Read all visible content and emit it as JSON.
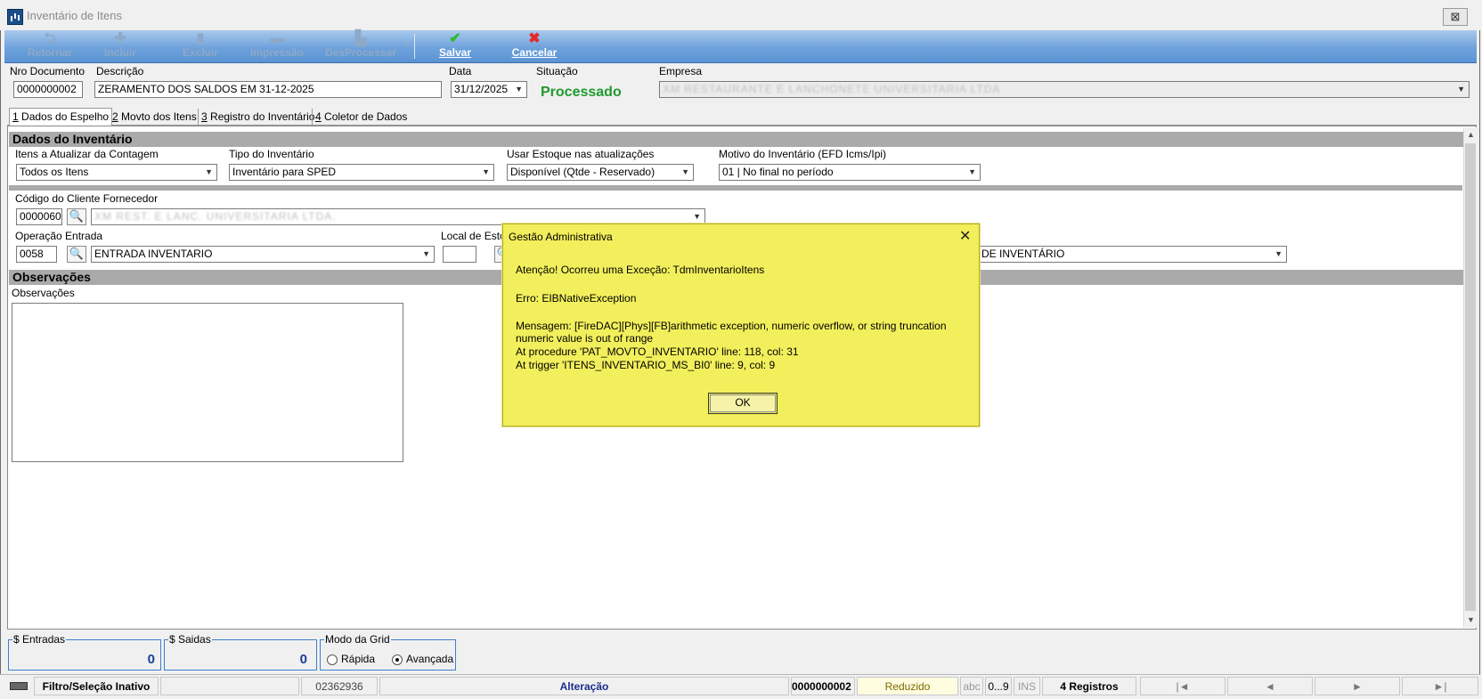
{
  "window": {
    "title": "Inventário de Itens",
    "close_glyph": "⊠"
  },
  "toolbar": {
    "retornar": "Retornar",
    "incluir": "Incluir",
    "excluir": "Excluir",
    "impressao": "Impressão",
    "desprocessar": "DesProcessar",
    "salvar": "Salvar",
    "cancelar": "Cancelar"
  },
  "header": {
    "nro_documento_label": "Nro Documento",
    "nro_documento_value": "0000000002",
    "descricao_label": "Descrição",
    "descricao_value": "ZERAMENTO DOS SALDOS EM 31-12-2025",
    "data_label": "Data",
    "data_value": "31/12/2025",
    "situacao_label": "Situação",
    "situacao_value": "Processado",
    "empresa_label": "Empresa",
    "empresa_value": "XM RESTAURANTE E LANCHONETE UNIVERSITARIA LTDA"
  },
  "tabs": [
    {
      "num": "1",
      "label": " Dados do Espelho"
    },
    {
      "num": "2",
      "label": " Movto dos Itens"
    },
    {
      "num": "3",
      "label": " Registro do Inventário"
    },
    {
      "num": "4",
      "label": " Coletor de Dados"
    }
  ],
  "dados": {
    "section_title": "Dados do Inventário",
    "itens_label": "Itens a Atualizar da Contagem",
    "itens_value": "Todos os Itens",
    "tipo_label": "Tipo do Inventário",
    "tipo_value": "Inventário para SPED",
    "usar_label": "Usar Estoque nas atualizações",
    "usar_value": "Disponível (Qtde - Reservado)",
    "motivo_label": "Motivo do Inventário (EFD Icms/Ipi)",
    "motivo_value": "01 | No final no período",
    "cliente_label": "Código do Cliente Fornecedor",
    "cliente_code": "0000060",
    "cliente_name": "XM REST. E LANC. UNIVERSITARIA LTDA.",
    "operacao_label": "Operação Entrada",
    "operacao_code": "0058",
    "operacao_name": "ENTRADA INVENTARIO",
    "local_label": "Local de Estoque",
    "right_combo_value": "DE INVENTÁRIO"
  },
  "observacoes": {
    "section_title": "Observações",
    "field_label": "Observações",
    "value": ""
  },
  "dialog": {
    "title": "Gestão Administrativa",
    "line1": "Atenção! Ocorreu uma Exceção: TdmInventarioItens",
    "line2": "Erro: EIBNativeException",
    "line3": " Mensagem: [FireDAC][Phys][FB]arithmetic exception, numeric overflow, or string truncation",
    "line4": "numeric value is out of range",
    "line5": "At procedure 'PAT_MOVTO_INVENTARIO' line: 118, col: 31",
    "line6": "At trigger 'ITENS_INVENTARIO_MS_BI0' line: 9, col: 9",
    "ok": "OK"
  },
  "totals": {
    "entradas_label": "$ Entradas",
    "entradas_value": "0",
    "saidas_label": "$ Saidas",
    "saidas_value": "0",
    "modo_label": "Modo da Grid",
    "rapida": "Rápida",
    "avancada": "Avançada",
    "modo_selected": "Avançada"
  },
  "statusbar": {
    "filtro": "Filtro/Seleção Inativo",
    "code": "02362936",
    "mode": "Alteração",
    "doc": "0000000002",
    "reduzido": "Reduzido",
    "abc": "abc",
    "range": "0...9",
    "ins": "INS",
    "registros": "4 Registros",
    "nav_first": "|◄",
    "nav_prev": "◄",
    "nav_next": "►",
    "nav_last": "►|"
  },
  "colors": {
    "toolbar_top": "#a9c9ec",
    "toolbar_bottom": "#5b93d3",
    "dialog_bg": "#f2ef5c",
    "status_ok": "#1f9a2c",
    "total_value": "#1a3d9c"
  }
}
